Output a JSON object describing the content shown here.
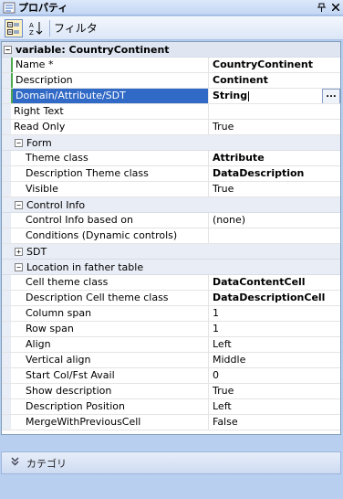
{
  "titlebar": {
    "title": "プロパティ",
    "pin_icon": "pin-icon",
    "close_icon": "close-icon"
  },
  "toolbar": {
    "filter_label": "フィルタ"
  },
  "grid": {
    "top_category": "variable: CountryContinent",
    "general": [
      {
        "name": "Name *",
        "value": "CountryContinent",
        "bold": true,
        "marked": true
      },
      {
        "name": "Description",
        "value": "Continent",
        "bold": true,
        "marked": true
      },
      {
        "name": "Domain/Attribute/SDT",
        "value": "String",
        "selected": true
      },
      {
        "name": "Right Text",
        "value": ""
      },
      {
        "name": "Read Only",
        "value": "True"
      }
    ],
    "form": {
      "label": "Form",
      "rows": [
        {
          "name": "Theme class",
          "value": "Attribute",
          "bold": true
        },
        {
          "name": "Description Theme class",
          "value": "DataDescription",
          "bold": true
        },
        {
          "name": "Visible",
          "value": "True"
        }
      ]
    },
    "control_info": {
      "label": "Control Info",
      "rows": [
        {
          "name": "Control Info based on",
          "value": "(none)"
        },
        {
          "name": "Conditions (Dynamic controls)",
          "value": ""
        }
      ]
    },
    "sdt": {
      "label": "SDT"
    },
    "location": {
      "label": "Location in father table",
      "rows": [
        {
          "name": "Cell theme class",
          "value": "DataContentCell",
          "bold": true
        },
        {
          "name": "Description Cell theme class",
          "value": "DataDescriptionCell",
          "bold": true
        },
        {
          "name": "Column span",
          "value": "1"
        },
        {
          "name": "Row span",
          "value": "1"
        },
        {
          "name": "Align",
          "value": "Left"
        },
        {
          "name": "Vertical align",
          "value": "Middle"
        },
        {
          "name": "Start Col/Fst Avail",
          "value": "0"
        },
        {
          "name": "Show description",
          "value": "True"
        },
        {
          "name": "Description Position",
          "value": "Left"
        },
        {
          "name": "MergeWithPreviousCell",
          "value": "False"
        }
      ]
    },
    "ellipsis_label": "..."
  },
  "footer": {
    "category_label": "カテゴリ"
  },
  "colors": {
    "selection": "#3169c6",
    "panel_bg": "#b8cff0",
    "marker": "#4ea84e"
  }
}
